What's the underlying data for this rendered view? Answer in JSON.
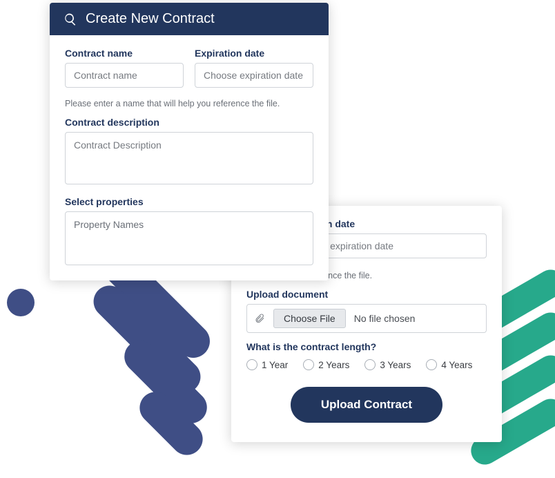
{
  "header": {
    "title": "Create New Contract"
  },
  "front": {
    "name_label": "Contract name",
    "name_placeholder": "Contract name",
    "exp_label": "Expiration date",
    "exp_placeholder": "Choose expiration date",
    "helper": "Please enter a name that will help you reference the file.",
    "desc_label": "Contract description",
    "desc_placeholder": "Contract Description",
    "props_label": "Select properties",
    "props_placeholder": "Property Names"
  },
  "back": {
    "exp_label": "Expiration date",
    "exp_placeholder": "Choose expiration date",
    "helper_tail": "at will help you reference the file.",
    "upload_label": "Upload document",
    "choose_label": "Choose File",
    "file_status": "No file chosen",
    "length_label": "What is the contract length?",
    "options": [
      "1 Year",
      "2 Years",
      "3 Years",
      "4 Years"
    ],
    "submit_label": "Upload Contract"
  }
}
